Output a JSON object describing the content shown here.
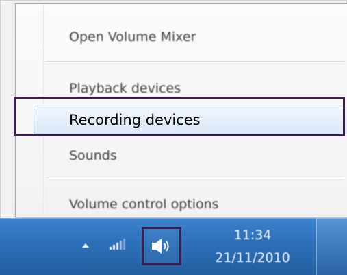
{
  "menu": {
    "items": [
      {
        "label": "Open Volume Mixer"
      },
      {
        "label": "Playback devices"
      },
      {
        "label": "Recording devices"
      },
      {
        "label": "Sounds"
      },
      {
        "label": "Volume control options"
      }
    ],
    "highlighted_item": "Recording devices"
  },
  "taskbar": {
    "tray_icons": [
      "show-hidden-icons-arrow",
      "network-signal-icon",
      "speaker-volume-icon"
    ],
    "clock": {
      "time": "11:34",
      "date": "21/11/2010"
    }
  },
  "colors": {
    "taskbar_blue": "#2c6fb8",
    "highlight_outline": "#3f1e4f",
    "selected_item_fill": "#dbe8f8"
  }
}
